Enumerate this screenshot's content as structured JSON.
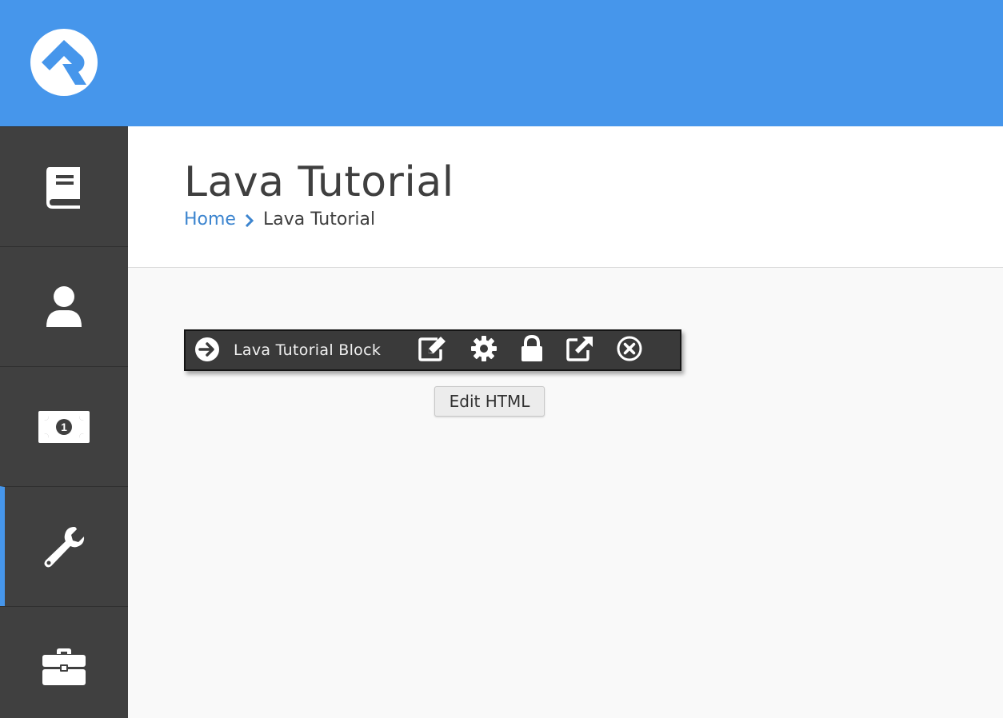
{
  "page": {
    "title": "Lava Tutorial",
    "breadcrumb": {
      "home": "Home",
      "current": "Lava Tutorial"
    }
  },
  "colors": {
    "accent": "#4696eb",
    "sidebar": "#404040",
    "link": "#3d85cf"
  },
  "sidebar": {
    "items": [
      {
        "icon": "book-icon",
        "active": false
      },
      {
        "icon": "user-icon",
        "active": false
      },
      {
        "icon": "money-bill-icon",
        "active": false
      },
      {
        "icon": "wrench-icon",
        "active": true
      },
      {
        "icon": "briefcase-icon",
        "active": false
      }
    ]
  },
  "block_toolbar": {
    "label": "Lava Tutorial Block",
    "icons": [
      "arrow-circle-right-icon",
      "edit-icon",
      "gear-icon",
      "lock-icon",
      "external-link-icon",
      "close-circle-icon"
    ]
  },
  "tooltip": {
    "text": "Edit HTML"
  }
}
